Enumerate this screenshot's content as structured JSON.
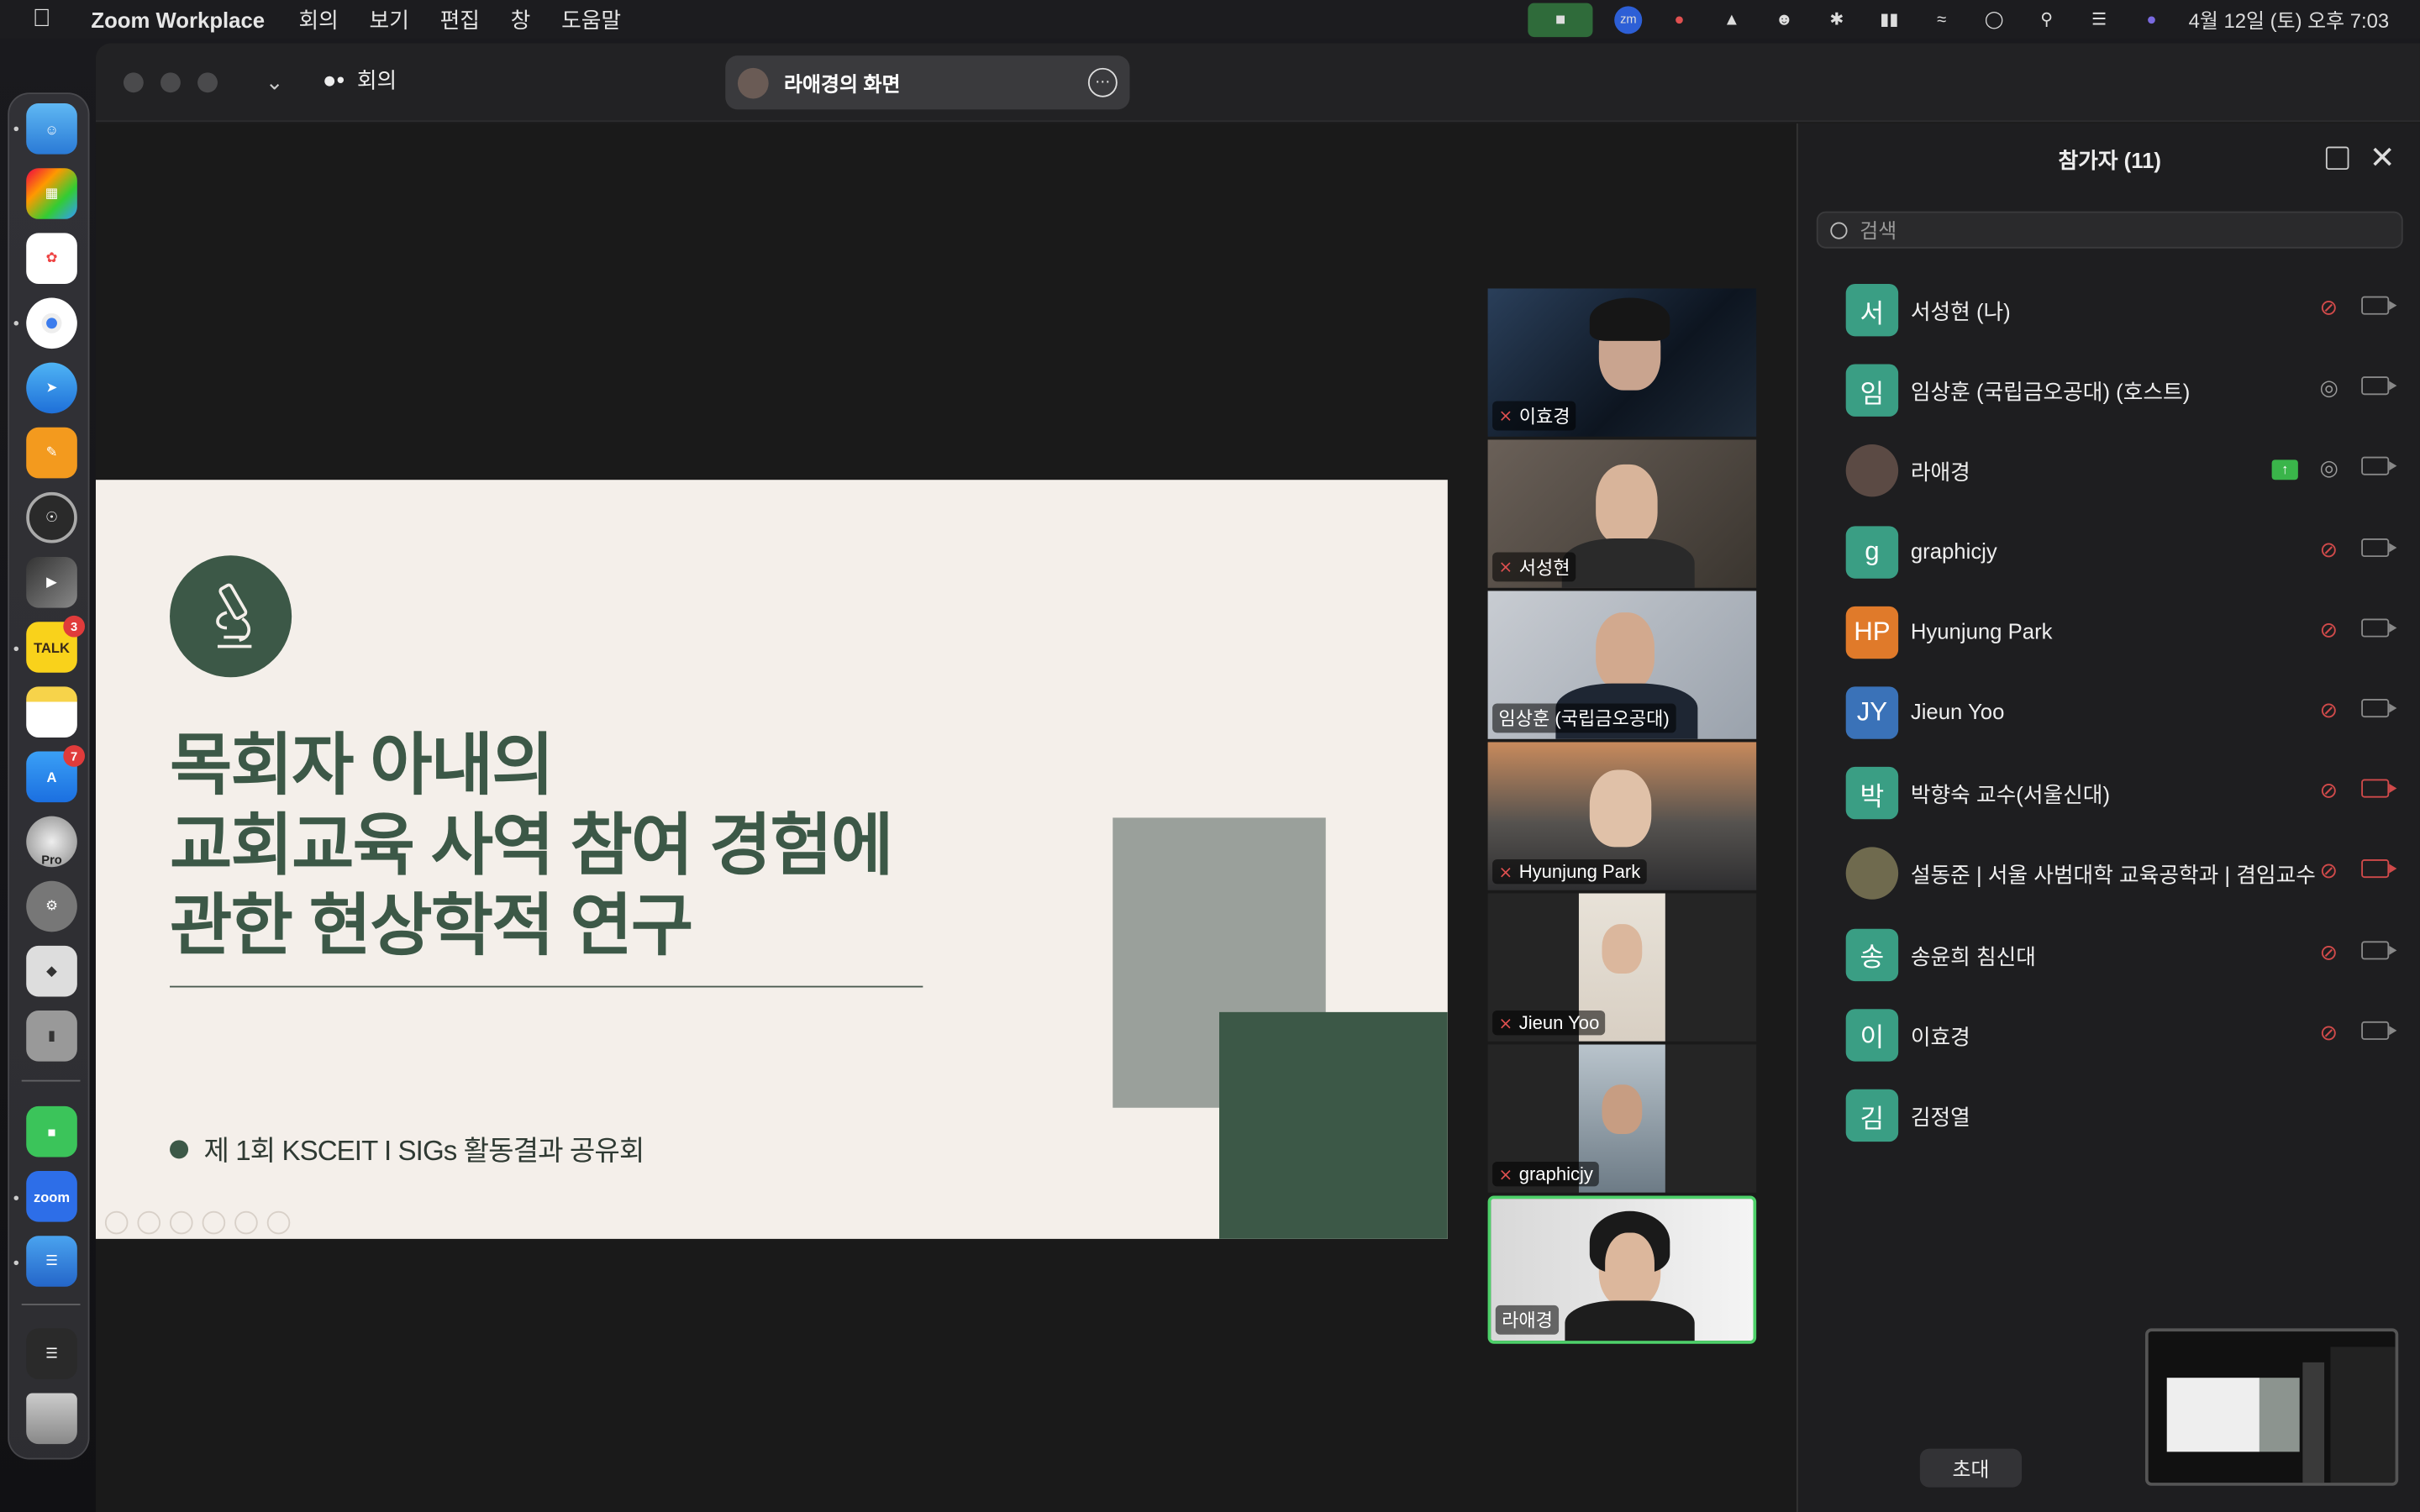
{
  "menubar": {
    "app_name": "Zoom Workplace",
    "menus": [
      "회의",
      "보기",
      "편집",
      "창",
      "도움말"
    ],
    "datetime": "4월 12일 (토) 오후 7:03"
  },
  "dock": {
    "talk_badge": "3",
    "appstore_badge": "7",
    "zoom_label": "zoom",
    "talk_label": "TALK",
    "pro_label": "Pro"
  },
  "window": {
    "meeting_label": "회의",
    "share_title": "라애경의 화면"
  },
  "slide": {
    "title_lines": [
      "목회자 아내의",
      "교회교육 사역 참여 경험에",
      "관한 현상학적 연구"
    ],
    "subtitle": "제 1회 KSCEIT Ι SIGs 활동결과 공유회"
  },
  "video_tiles": [
    {
      "name": "이효경",
      "muted": true
    },
    {
      "name": "서성현",
      "muted": true
    },
    {
      "name": "임상훈 (국립금오공대)",
      "muted": false
    },
    {
      "name": "Hyunjung Park",
      "muted": true
    },
    {
      "name": "Jieun Yoo",
      "muted": true
    },
    {
      "name": "graphicjy",
      "muted": true
    },
    {
      "name": "라애경",
      "muted": false
    }
  ],
  "participants": {
    "title": "참가자 (11)",
    "search_placeholder": "검색",
    "invite_label": "초대",
    "list": [
      {
        "initial": "서",
        "name": "서성현 (나)",
        "color": "#3a9e84",
        "mic": "muted",
        "cam": "on"
      },
      {
        "initial": "임",
        "name": "임상훈 (국립금오공대) (호스트)",
        "color": "#3a9e84",
        "mic": "on",
        "cam": "on"
      },
      {
        "initial": "",
        "name": "라애경",
        "color": "#5b4a44",
        "mic": "on",
        "cam": "on",
        "sharing": true
      },
      {
        "initial": "g",
        "name": "graphicjy",
        "color": "#3a9e84",
        "mic": "muted",
        "cam": "on"
      },
      {
        "initial": "HP",
        "name": "Hyunjung Park",
        "color": "#e07a2a",
        "mic": "muted",
        "cam": "on"
      },
      {
        "initial": "JY",
        "name": "Jieun Yoo",
        "color": "#3a72b8",
        "mic": "muted",
        "cam": "on"
      },
      {
        "initial": "박",
        "name": "박향숙 교수(서울신대)",
        "color": "#3a9e84",
        "mic": "muted",
        "cam": "off"
      },
      {
        "initial": "",
        "name": "설동준 | 서울 사범대학 교육공학과 | 겸임교수",
        "color": "#6f6a4e",
        "mic": "muted",
        "cam": "off"
      },
      {
        "initial": "송",
        "name": "송윤희 침신대",
        "color": "#3a9e84",
        "mic": "muted",
        "cam": "on"
      },
      {
        "initial": "이",
        "name": "이효경",
        "color": "#3a9e84",
        "mic": "muted",
        "cam": "on"
      },
      {
        "initial": "김",
        "name": "김정열",
        "color": "#3a9e84",
        "mic": "none",
        "cam": "none"
      }
    ]
  }
}
